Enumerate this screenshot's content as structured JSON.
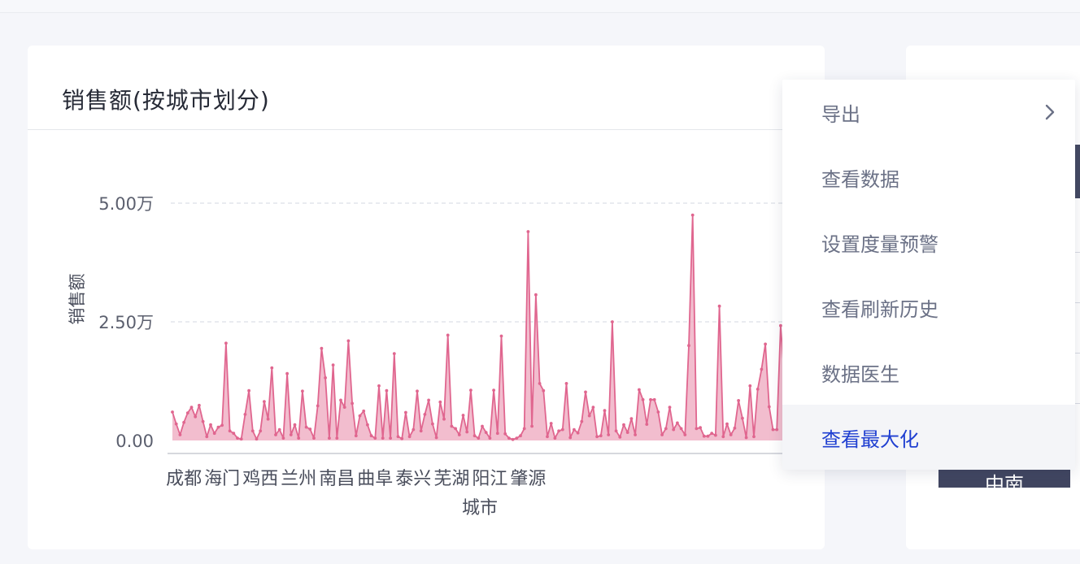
{
  "card": {
    "title": "销售额(按城市划分)"
  },
  "menu": {
    "items": [
      {
        "label": "导出",
        "has_submenu": true
      },
      {
        "label": "查看数据"
      },
      {
        "label": "设置度量预警"
      },
      {
        "label": "查看刷新历史"
      },
      {
        "label": "数据医生"
      },
      {
        "label": "查看最大化",
        "active": true
      }
    ]
  },
  "side_panel": {
    "tag_text": "中南"
  },
  "colors": {
    "series": "#e0668f",
    "area": "#f0b1c6",
    "menu_active": "#1f3fd1",
    "tag": "#414661"
  },
  "chart_data": {
    "type": "area",
    "ylabel": "销售额",
    "xlabel": "城市",
    "yticks": [
      {
        "value": 0,
        "label": "0.00"
      },
      {
        "value": 25000,
        "label": "2.50万"
      },
      {
        "value": 50000,
        "label": "5.00万"
      }
    ],
    "ylim": [
      0,
      50000
    ],
    "x_tick_labels": [
      {
        "index": 3,
        "label": "成都"
      },
      {
        "index": 13,
        "label": "海门"
      },
      {
        "index": 23,
        "label": "鸡西"
      },
      {
        "index": 33,
        "label": "兰州"
      },
      {
        "index": 43,
        "label": "南昌"
      },
      {
        "index": 53,
        "label": "曲阜"
      },
      {
        "index": 63,
        "label": "泰兴"
      },
      {
        "index": 73,
        "label": "芜湖"
      },
      {
        "index": 83,
        "label": "阳江"
      },
      {
        "index": 93,
        "label": "肇源"
      }
    ],
    "grid": true,
    "values": [
      6000,
      3500,
      1200,
      3800,
      5800,
      7000,
      5000,
      7400,
      4000,
      800,
      3300,
      1500,
      2800,
      3200,
      20500,
      2000,
      1500,
      500,
      300,
      5500,
      10500,
      2000,
      300,
      2000,
      8200,
      4500,
      15300,
      1200,
      2300,
      500,
      14100,
      1200,
      3300,
      500,
      10400,
      2800,
      2400,
      500,
      7300,
      19400,
      13200,
      500,
      15900,
      500,
      8500,
      7000,
      21000,
      7800,
      1000,
      5200,
      6200,
      3300,
      1000,
      500,
      11500,
      500,
      10500,
      500,
      18300,
      800,
      400,
      5900,
      800,
      2300,
      10400,
      2000,
      5500,
      8500,
      3500,
      600,
      8100,
      4500,
      22200,
      3000,
      2500,
      1200,
      5300,
      1800,
      10600,
      1000,
      500,
      3000,
      1700,
      500,
      10600,
      1500,
      22000,
      1400,
      500,
      200,
      500,
      1000,
      2500,
      44000,
      3000,
      30700,
      12000,
      10500,
      800,
      3600,
      500,
      2000,
      2300,
      12000,
      600,
      2300,
      1600,
      4000,
      10200,
      5200,
      7000,
      800,
      1000,
      6300,
      1200,
      25000,
      2000,
      700,
      3300,
      1700,
      4600,
      1200,
      10700,
      8600,
      3400,
      8600,
      8600,
      6000,
      1200,
      2500,
      7000,
      2300,
      3700,
      2500,
      1200,
      20000,
      47500,
      2500,
      2700,
      900,
      900,
      1500,
      1100,
      28300,
      800,
      3500,
      1200,
      2600,
      8400,
      4700,
      600,
      11500,
      800,
      10800,
      15000,
      20300,
      7100,
      2300,
      2300,
      24200,
      13000,
      2500,
      2500
    ]
  }
}
